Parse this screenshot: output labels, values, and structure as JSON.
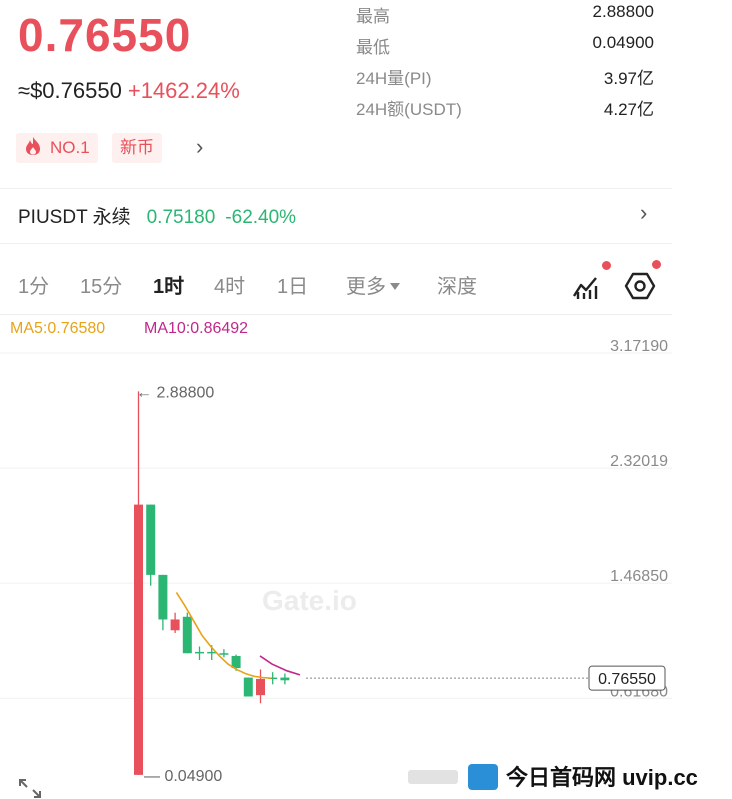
{
  "ticker": {
    "last_price": "0.76550",
    "usd_equiv": "≈$0.76550",
    "change_pct": "+1462.24%",
    "tags": {
      "hot_rank": "NO.1",
      "new_coin": "新币"
    }
  },
  "stats": [
    {
      "label": "最高",
      "value": "2.88800"
    },
    {
      "label": "最低",
      "value": "0.04900"
    },
    {
      "label": "24H量(PI)",
      "value": "3.97亿"
    },
    {
      "label": "24H额(USDT)",
      "value": "4.27亿"
    }
  ],
  "contract": {
    "name": "PIUSDT 永续",
    "price": "0.75180",
    "change": "-62.40%"
  },
  "tabs": [
    {
      "label": "1分",
      "active": false
    },
    {
      "label": "15分",
      "active": false
    },
    {
      "label": "1时",
      "active": true
    },
    {
      "label": "4时",
      "active": false
    },
    {
      "label": "1日",
      "active": false
    },
    {
      "label": "更多",
      "active": false
    },
    {
      "label": "深度",
      "active": false
    }
  ],
  "icons": {
    "indicator": "chart-indicator-icon",
    "settings": "hexagon-settings-icon",
    "expand": "expand-icon",
    "hot": "flame-icon"
  },
  "ma": {
    "ma5": "MA5:0.76580",
    "ma10": "MA10:0.86492"
  },
  "colors": {
    "up": "#2bb673",
    "down": "#e8505b",
    "ma5": "#e8a317",
    "ma10": "#c2278b"
  },
  "chart_data": {
    "type": "candlestick",
    "y_range": [
      0.049,
      3.1719
    ],
    "y_axis_ticks": [
      "3.17190",
      "2.32019",
      "1.46850",
      "0.61680"
    ],
    "current_price_label": "0.76550",
    "current_price": 0.7655,
    "high_marker": "← 2.88800",
    "high_value": 2.888,
    "low_marker": "— 0.04900",
    "low_value": 0.049,
    "watermark": "Gate.io",
    "candles": [
      {
        "o": 0.05,
        "h": 2.888,
        "l": 0.049,
        "c": 2.05,
        "dir": "up"
      },
      {
        "o": 2.05,
        "h": 2.05,
        "l": 1.45,
        "c": 1.53,
        "dir": "down"
      },
      {
        "o": 1.53,
        "h": 1.53,
        "l": 1.12,
        "c": 1.2,
        "dir": "down"
      },
      {
        "o": 1.12,
        "h": 1.25,
        "l": 1.1,
        "c": 1.2,
        "dir": "up"
      },
      {
        "o": 1.22,
        "h": 1.25,
        "l": 0.95,
        "c": 0.95,
        "dir": "down"
      },
      {
        "o": 0.95,
        "h": 1.0,
        "l": 0.9,
        "c": 0.96,
        "dir": "doji"
      },
      {
        "o": 0.96,
        "h": 1.01,
        "l": 0.9,
        "c": 0.96,
        "dir": "doji"
      },
      {
        "o": 0.95,
        "h": 0.98,
        "l": 0.92,
        "c": 0.95,
        "dir": "doji"
      },
      {
        "o": 0.93,
        "h": 0.94,
        "l": 0.82,
        "c": 0.84,
        "dir": "down"
      },
      {
        "o": 0.77,
        "h": 0.77,
        "l": 0.63,
        "c": 0.63,
        "dir": "down"
      },
      {
        "o": 0.64,
        "h": 0.83,
        "l": 0.58,
        "c": 0.76,
        "dir": "up"
      },
      {
        "o": 0.77,
        "h": 0.81,
        "l": 0.72,
        "c": 0.77,
        "dir": "doji"
      },
      {
        "o": 0.77,
        "h": 0.8,
        "l": 0.72,
        "c": 0.75,
        "dir": "down"
      }
    ],
    "ma5_series": [
      null,
      null,
      null,
      null,
      1.4,
      1.3,
      1.19,
      1.08,
      1.0,
      0.93,
      0.87,
      0.83,
      0.8,
      0.78,
      0.77,
      0.766
    ],
    "ma10_series": [
      null,
      null,
      null,
      null,
      null,
      null,
      null,
      null,
      null,
      1.16,
      1.1,
      1.03,
      0.96,
      0.92,
      0.88,
      0.865
    ]
  },
  "footer": {
    "brand": "今日首码网 uvip.cc"
  }
}
